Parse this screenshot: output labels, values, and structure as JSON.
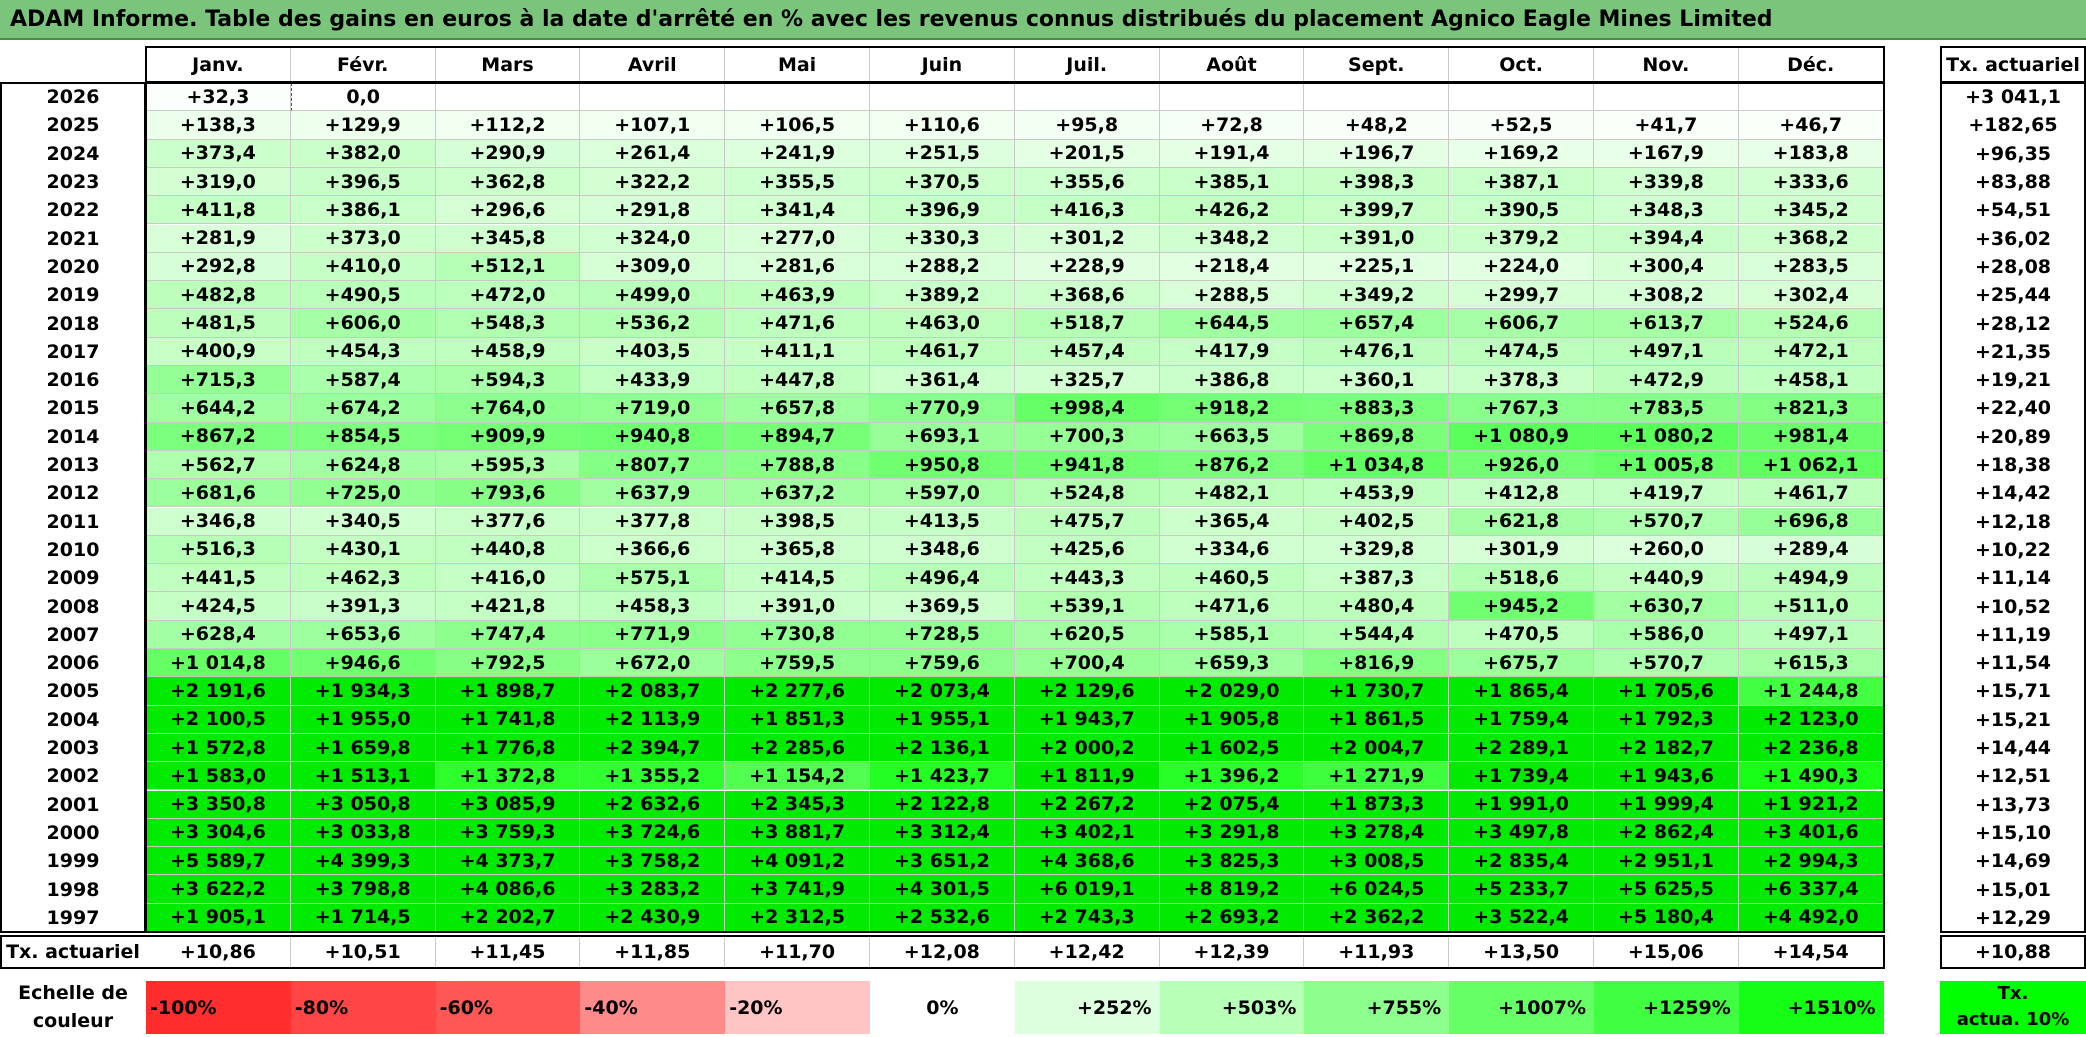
{
  "title": "ADAM Informe. Table des gains en euros à la date d'arrêté en % avec les revenus connus distribués du placement Agnico Eagle Mines Limited",
  "chart_data": {
    "type": "table",
    "title": "ADAM Informe. Table des gains en euros à la date d'arrêté en % avec les revenus connus distribués du placement Agnico Eagle Mines Limited",
    "columns": [
      "Janv.",
      "Févr.",
      "Mars",
      "Avril",
      "Mai",
      "Juin",
      "Juil.",
      "Août",
      "Sept.",
      "Oct.",
      "Nov.",
      "Déc."
    ],
    "summary_column_label": "Tx. actuariel",
    "rows": [
      {
        "year": "2026",
        "values": [
          "+32,3",
          "0,0",
          "",
          "",
          "",
          "",
          "",
          "",
          "",
          "",
          "",
          ""
        ],
        "rate": "+3 041,1"
      },
      {
        "year": "2025",
        "values": [
          "+138,3",
          "+129,9",
          "+112,2",
          "+107,1",
          "+106,5",
          "+110,6",
          "+95,8",
          "+72,8",
          "+48,2",
          "+52,5",
          "+41,7",
          "+46,7"
        ],
        "rate": "+182,65"
      },
      {
        "year": "2024",
        "values": [
          "+373,4",
          "+382,0",
          "+290,9",
          "+261,4",
          "+241,9",
          "+251,5",
          "+201,5",
          "+191,4",
          "+196,7",
          "+169,2",
          "+167,9",
          "+183,8"
        ],
        "rate": "+96,35"
      },
      {
        "year": "2023",
        "values": [
          "+319,0",
          "+396,5",
          "+362,8",
          "+322,2",
          "+355,5",
          "+370,5",
          "+355,6",
          "+385,1",
          "+398,3",
          "+387,1",
          "+339,8",
          "+333,6"
        ],
        "rate": "+83,88"
      },
      {
        "year": "2022",
        "values": [
          "+411,8",
          "+386,1",
          "+296,6",
          "+291,8",
          "+341,4",
          "+396,9",
          "+416,3",
          "+426,2",
          "+399,7",
          "+390,5",
          "+348,3",
          "+345,2"
        ],
        "rate": "+54,51"
      },
      {
        "year": "2021",
        "values": [
          "+281,9",
          "+373,0",
          "+345,8",
          "+324,0",
          "+277,0",
          "+330,3",
          "+301,2",
          "+348,2",
          "+391,0",
          "+379,2",
          "+394,4",
          "+368,2"
        ],
        "rate": "+36,02"
      },
      {
        "year": "2020",
        "values": [
          "+292,8",
          "+410,0",
          "+512,1",
          "+309,0",
          "+281,6",
          "+288,2",
          "+228,9",
          "+218,4",
          "+225,1",
          "+224,0",
          "+300,4",
          "+283,5"
        ],
        "rate": "+28,08"
      },
      {
        "year": "2019",
        "values": [
          "+482,8",
          "+490,5",
          "+472,0",
          "+499,0",
          "+463,9",
          "+389,2",
          "+368,6",
          "+288,5",
          "+349,2",
          "+299,7",
          "+308,2",
          "+302,4"
        ],
        "rate": "+25,44"
      },
      {
        "year": "2018",
        "values": [
          "+481,5",
          "+606,0",
          "+548,3",
          "+536,2",
          "+471,6",
          "+463,0",
          "+518,7",
          "+644,5",
          "+657,4",
          "+606,7",
          "+613,7",
          "+524,6"
        ],
        "rate": "+28,12"
      },
      {
        "year": "2017",
        "values": [
          "+400,9",
          "+454,3",
          "+458,9",
          "+403,5",
          "+411,1",
          "+461,7",
          "+457,4",
          "+417,9",
          "+476,1",
          "+474,5",
          "+497,1",
          "+472,1"
        ],
        "rate": "+21,35"
      },
      {
        "year": "2016",
        "values": [
          "+715,3",
          "+587,4",
          "+594,3",
          "+433,9",
          "+447,8",
          "+361,4",
          "+325,7",
          "+386,8",
          "+360,1",
          "+378,3",
          "+472,9",
          "+458,1"
        ],
        "rate": "+19,21"
      },
      {
        "year": "2015",
        "values": [
          "+644,2",
          "+674,2",
          "+764,0",
          "+719,0",
          "+657,8",
          "+770,9",
          "+998,4",
          "+918,2",
          "+883,3",
          "+767,3",
          "+783,5",
          "+821,3"
        ],
        "rate": "+22,40"
      },
      {
        "year": "2014",
        "values": [
          "+867,2",
          "+854,5",
          "+909,9",
          "+940,8",
          "+894,7",
          "+693,1",
          "+700,3",
          "+663,5",
          "+869,8",
          "+1 080,9",
          "+1 080,2",
          "+981,4"
        ],
        "rate": "+20,89"
      },
      {
        "year": "2013",
        "values": [
          "+562,7",
          "+624,8",
          "+595,3",
          "+807,7",
          "+788,8",
          "+950,8",
          "+941,8",
          "+876,2",
          "+1 034,8",
          "+926,0",
          "+1 005,8",
          "+1 062,1"
        ],
        "rate": "+18,38"
      },
      {
        "year": "2012",
        "values": [
          "+681,6",
          "+725,0",
          "+793,6",
          "+637,9",
          "+637,2",
          "+597,0",
          "+524,8",
          "+482,1",
          "+453,9",
          "+412,8",
          "+419,7",
          "+461,7"
        ],
        "rate": "+14,42"
      },
      {
        "year": "2011",
        "values": [
          "+346,8",
          "+340,5",
          "+377,6",
          "+377,8",
          "+398,5",
          "+413,5",
          "+475,7",
          "+365,4",
          "+402,5",
          "+621,8",
          "+570,7",
          "+696,8"
        ],
        "rate": "+12,18"
      },
      {
        "year": "2010",
        "values": [
          "+516,3",
          "+430,1",
          "+440,8",
          "+366,6",
          "+365,8",
          "+348,6",
          "+425,6",
          "+334,6",
          "+329,8",
          "+301,9",
          "+260,0",
          "+289,4"
        ],
        "rate": "+10,22"
      },
      {
        "year": "2009",
        "values": [
          "+441,5",
          "+462,3",
          "+416,0",
          "+575,1",
          "+414,5",
          "+496,4",
          "+443,3",
          "+460,5",
          "+387,3",
          "+518,6",
          "+440,9",
          "+494,9"
        ],
        "rate": "+11,14"
      },
      {
        "year": "2008",
        "values": [
          "+424,5",
          "+391,3",
          "+421,8",
          "+458,3",
          "+391,0",
          "+369,5",
          "+539,1",
          "+471,6",
          "+480,4",
          "+945,2",
          "+630,7",
          "+511,0"
        ],
        "rate": "+10,52"
      },
      {
        "year": "2007",
        "values": [
          "+628,4",
          "+653,6",
          "+747,4",
          "+771,9",
          "+730,8",
          "+728,5",
          "+620,5",
          "+585,1",
          "+544,4",
          "+470,5",
          "+586,0",
          "+497,1"
        ],
        "rate": "+11,19"
      },
      {
        "year": "2006",
        "values": [
          "+1 014,8",
          "+946,6",
          "+792,5",
          "+672,0",
          "+759,5",
          "+759,6",
          "+700,4",
          "+659,3",
          "+816,9",
          "+675,7",
          "+570,7",
          "+615,3"
        ],
        "rate": "+11,54"
      },
      {
        "year": "2005",
        "values": [
          "+2 191,6",
          "+1 934,3",
          "+1 898,7",
          "+2 083,7",
          "+2 277,6",
          "+2 073,4",
          "+2 129,6",
          "+2 029,0",
          "+1 730,7",
          "+1 865,4",
          "+1 705,6",
          "+1 244,8"
        ],
        "rate": "+15,71"
      },
      {
        "year": "2004",
        "values": [
          "+2 100,5",
          "+1 955,0",
          "+1 741,8",
          "+2 113,9",
          "+1 851,3",
          "+1 955,1",
          "+1 943,7",
          "+1 905,8",
          "+1 861,5",
          "+1 759,4",
          "+1 792,3",
          "+2 123,0"
        ],
        "rate": "+15,21"
      },
      {
        "year": "2003",
        "values": [
          "+1 572,8",
          "+1 659,8",
          "+1 776,8",
          "+2 394,7",
          "+2 285,6",
          "+2 136,1",
          "+2 000,2",
          "+1 602,5",
          "+2 004,7",
          "+2 289,1",
          "+2 182,7",
          "+2 236,8"
        ],
        "rate": "+14,44"
      },
      {
        "year": "2002",
        "values": [
          "+1 583,0",
          "+1 513,1",
          "+1 372,8",
          "+1 355,2",
          "+1 154,2",
          "+1 423,7",
          "+1 811,9",
          "+1 396,2",
          "+1 271,9",
          "+1 739,4",
          "+1 943,6",
          "+1 490,3"
        ],
        "rate": "+12,51"
      },
      {
        "year": "2001",
        "values": [
          "+3 350,8",
          "+3 050,8",
          "+3 085,9",
          "+2 632,6",
          "+2 345,3",
          "+2 122,8",
          "+2 267,2",
          "+2 075,4",
          "+1 873,3",
          "+1 991,0",
          "+1 999,4",
          "+1 921,2"
        ],
        "rate": "+13,73"
      },
      {
        "year": "2000",
        "values": [
          "+3 304,6",
          "+3 033,8",
          "+3 759,3",
          "+3 724,6",
          "+3 881,7",
          "+3 312,4",
          "+3 402,1",
          "+3 291,8",
          "+3 278,4",
          "+3 497,8",
          "+2 862,4",
          "+3 401,6"
        ],
        "rate": "+15,10"
      },
      {
        "year": "1999",
        "values": [
          "+5 589,7",
          "+4 399,3",
          "+4 373,7",
          "+3 758,2",
          "+4 091,2",
          "+3 651,2",
          "+4 368,6",
          "+3 825,3",
          "+3 008,5",
          "+2 835,4",
          "+2 951,1",
          "+2 994,3"
        ],
        "rate": "+14,69"
      },
      {
        "year": "1998",
        "values": [
          "+3 622,2",
          "+3 798,8",
          "+4 086,6",
          "+3 283,2",
          "+3 741,9",
          "+4 301,5",
          "+6 019,1",
          "+8 819,2",
          "+6 024,5",
          "+5 233,7",
          "+5 625,5",
          "+6 337,4"
        ],
        "rate": "+15,01"
      },
      {
        "year": "1997",
        "values": [
          "+1 905,1",
          "+1 714,5",
          "+2 202,7",
          "+2 430,9",
          "+2 312,5",
          "+2 532,6",
          "+2 743,3",
          "+2 693,2",
          "+2 362,2",
          "+3 522,4",
          "+5 180,4",
          "+4 492,0"
        ],
        "rate": "+12,29"
      }
    ],
    "bottom_row": {
      "label": "Tx. actuariel",
      "values": [
        "+10,86",
        "+10,51",
        "+11,45",
        "+11,85",
        "+11,70",
        "+12,08",
        "+12,42",
        "+12,39",
        "+11,93",
        "+13,50",
        "+15,06",
        "+14,54"
      ],
      "total": "+10,88"
    },
    "color_scale": {
      "label_line1": "Echelle de",
      "label_line2": "couleur",
      "stops": [
        {
          "label": "-100%",
          "color": "#ff2d2d"
        },
        {
          "label": "-80%",
          "color": "#ff4545"
        },
        {
          "label": "-60%",
          "color": "#ff5656"
        },
        {
          "label": "-40%",
          "color": "#ff8a8a"
        },
        {
          "label": "-20%",
          "color": "#ffc4c4"
        },
        {
          "label": "0%",
          "color": "#ffffff"
        },
        {
          "label": "+252%",
          "color": "#ddffdd"
        },
        {
          "label": "+503%",
          "color": "#b8ffb8"
        },
        {
          "label": "+755%",
          "color": "#8dff8d"
        },
        {
          "label": "+1007%",
          "color": "#66ff66"
        },
        {
          "label": "+1259%",
          "color": "#40ff40"
        },
        {
          "label": "+1510%",
          "color": "#14ff14"
        }
      ],
      "legend_line1": "Tx.",
      "legend_line2": "actua. 10%",
      "legend_color": "#00ff00"
    }
  }
}
